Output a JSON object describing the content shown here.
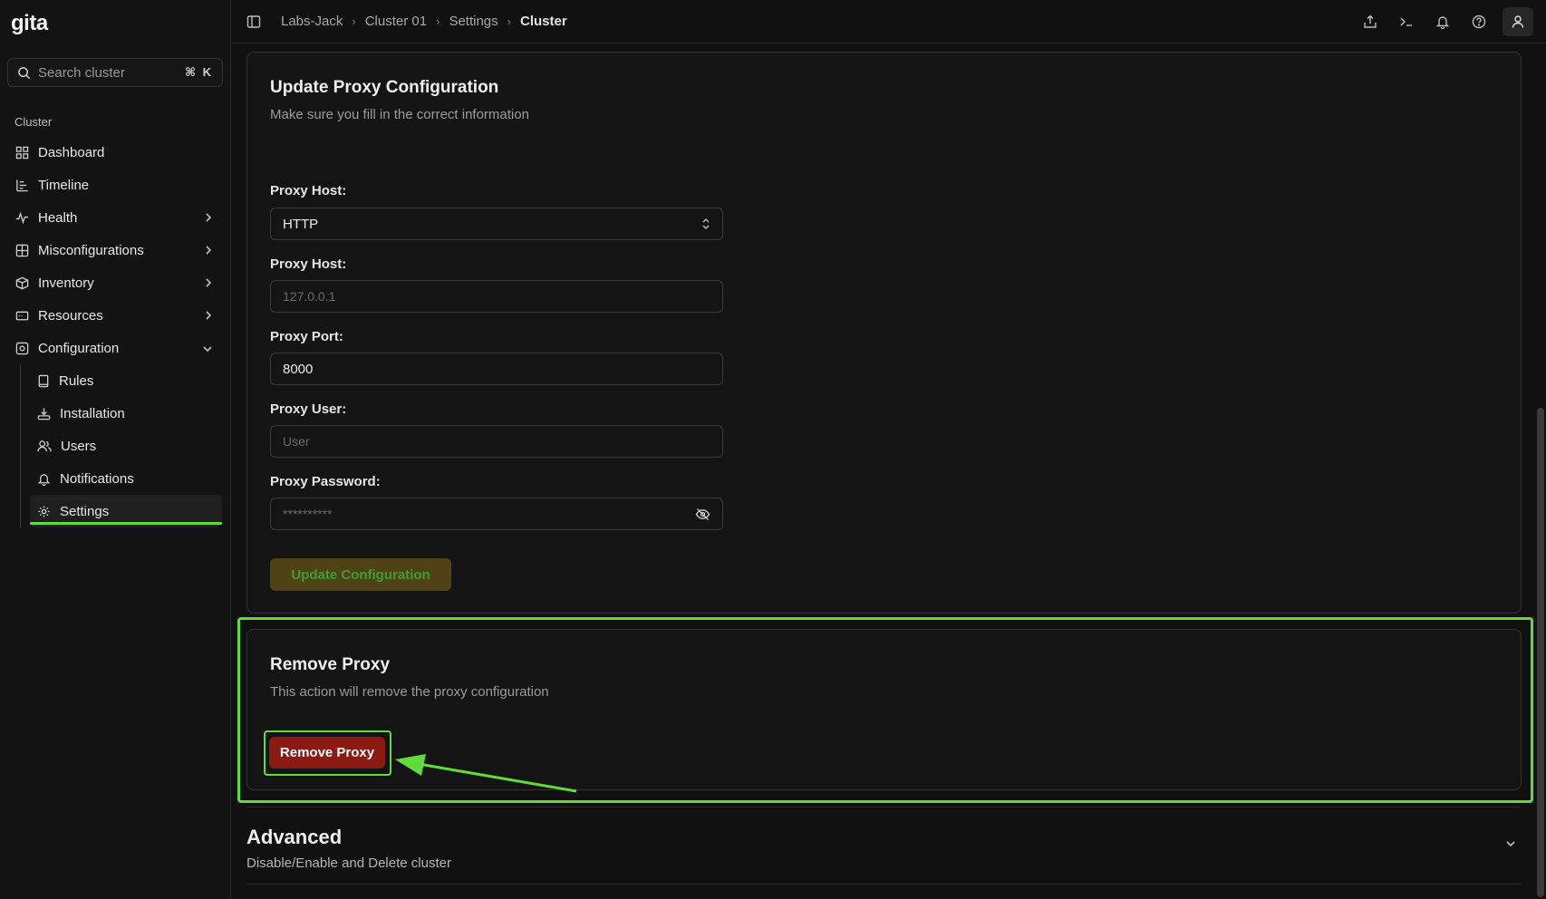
{
  "app": {
    "logo": "gita"
  },
  "search": {
    "placeholder": "Search cluster",
    "shortcut": "⌘ K"
  },
  "sidebar": {
    "section_label": "Cluster",
    "items": [
      {
        "label": "Dashboard",
        "icon": "grid-icon"
      },
      {
        "label": "Timeline",
        "icon": "timeline-icon"
      },
      {
        "label": "Health",
        "icon": "pulse-icon",
        "expandable": true
      },
      {
        "label": "Misconfigurations",
        "icon": "misconfig-icon",
        "expandable": true
      },
      {
        "label": "Inventory",
        "icon": "cube-icon",
        "expandable": true
      },
      {
        "label": "Resources",
        "icon": "resources-icon",
        "expandable": true
      },
      {
        "label": "Configuration",
        "icon": "config-icon",
        "expanded": true
      }
    ],
    "sub_items": [
      {
        "label": "Rules",
        "icon": "book-icon"
      },
      {
        "label": "Installation",
        "icon": "install-icon"
      },
      {
        "label": "Users",
        "icon": "users-icon"
      },
      {
        "label": "Notifications",
        "icon": "bell-icon"
      },
      {
        "label": "Settings",
        "icon": "gear-icon",
        "active": true
      }
    ]
  },
  "breadcrumb": [
    "Labs-Jack",
    "Cluster 01",
    "Settings",
    "Cluster"
  ],
  "proxy_config": {
    "title": "Update Proxy Configuration",
    "subtitle": "Make sure you fill in the correct information",
    "protocol_label": "Proxy Host:",
    "protocol_value": "HTTP",
    "host_label": "Proxy Host:",
    "host_placeholder": "127.0.0.1",
    "port_label": "Proxy Port:",
    "port_value": "8000",
    "user_label": "Proxy User:",
    "user_placeholder": "User",
    "password_label": "Proxy Password:",
    "password_placeholder": "**********",
    "update_button": "Update Configuration"
  },
  "remove_proxy": {
    "title": "Remove Proxy",
    "subtitle": "This action will remove the proxy configuration",
    "button": "Remove Proxy"
  },
  "advanced": {
    "title": "Advanced",
    "subtitle": "Disable/Enable and Delete cluster"
  },
  "colors": {
    "accent_highlight": "#5fdc3a",
    "danger": "#8b1a12",
    "update_button_bg": "#4f4316"
  }
}
